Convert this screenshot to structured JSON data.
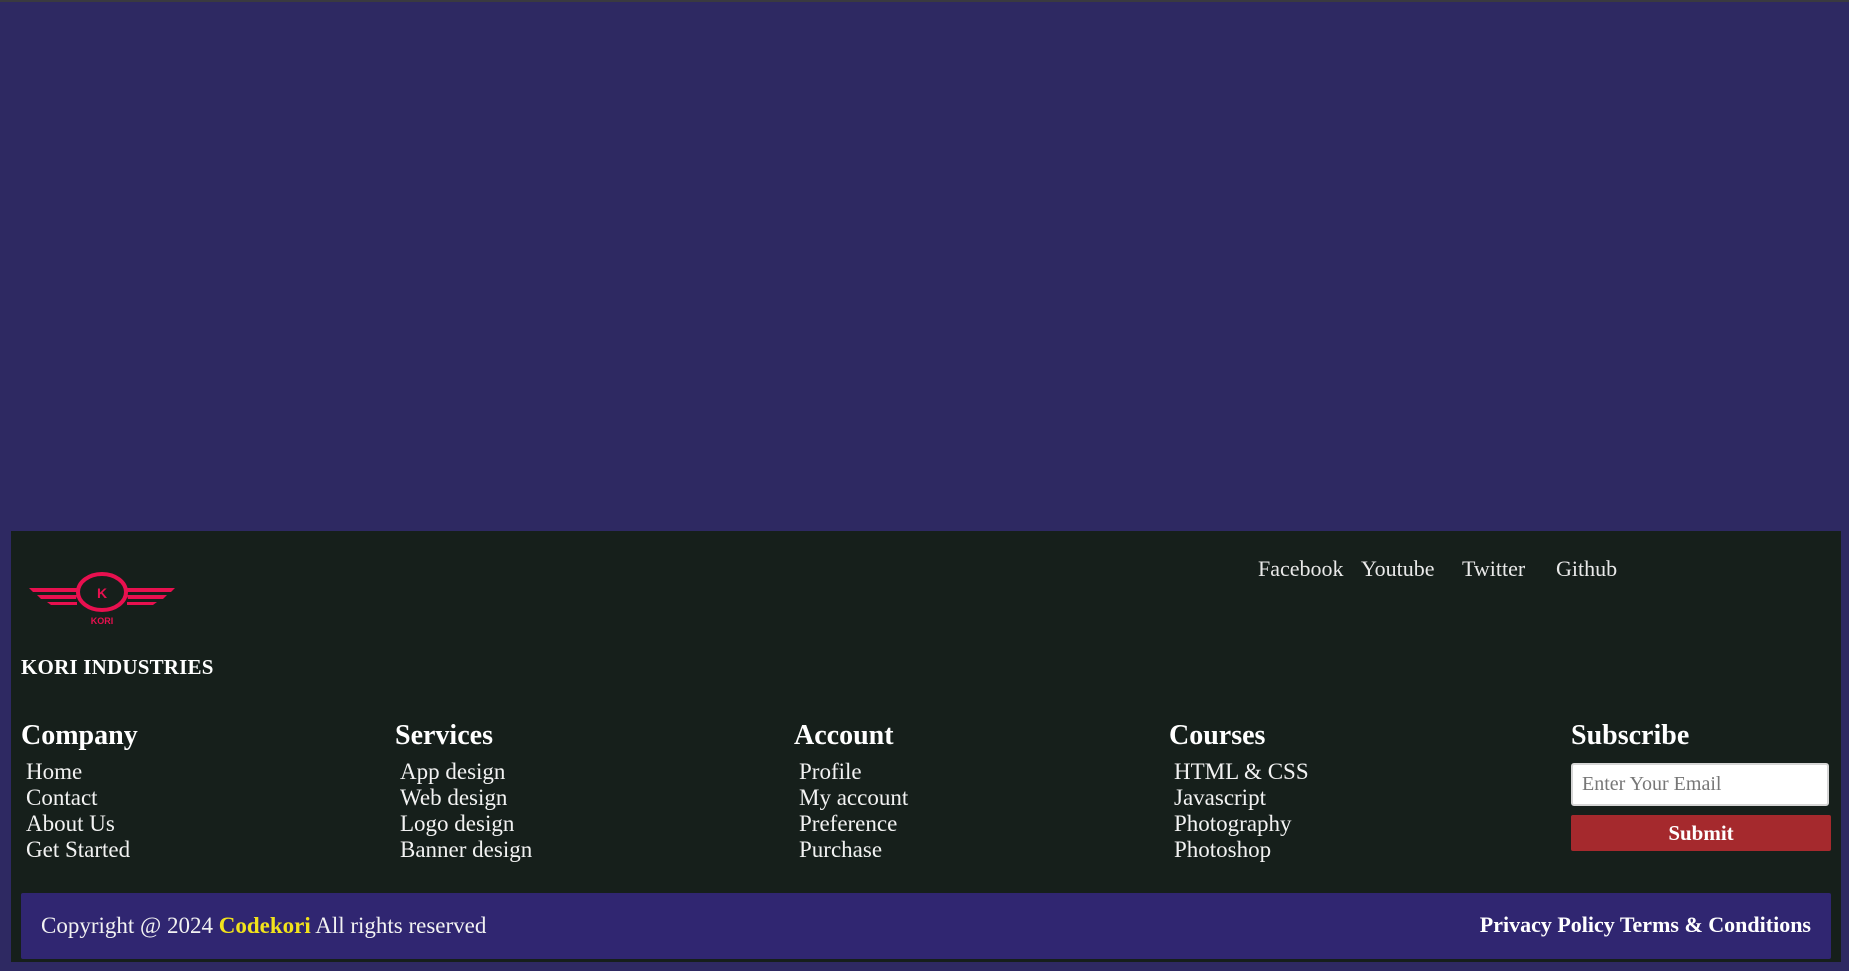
{
  "brand": {
    "logo_label": "KORI",
    "logo_letter": "K",
    "name": "KORI INDUSTRIES",
    "logo_color": "#e8104f"
  },
  "social": {
    "facebook": "Facebook",
    "youtube": "Youtube",
    "twitter": "Twitter",
    "github": "Github"
  },
  "columns": {
    "company": {
      "title": "Company",
      "items": [
        "Home",
        "Contact",
        "About Us",
        "Get Started"
      ]
    },
    "services": {
      "title": "Services",
      "items": [
        "App design",
        "Web design",
        "Logo design",
        "Banner design"
      ]
    },
    "account": {
      "title": "Account",
      "items": [
        "Profile",
        "My account",
        "Preference",
        "Purchase"
      ]
    },
    "courses": {
      "title": "Courses",
      "items": [
        "HTML & CSS",
        "Javascript",
        "Photography",
        "Photoshop"
      ]
    }
  },
  "subscribe": {
    "title": "Subscribe",
    "placeholder": "Enter Your Email",
    "value": "",
    "button_label": "Submit"
  },
  "copyright": {
    "prefix": "Copyright @ 2024",
    "brand": "Codekori",
    "suffix": "All rights reserved"
  },
  "legal": {
    "privacy": "Privacy Policy",
    "terms": "Terms & Conditions"
  },
  "colors": {
    "page_background": "#2e2962",
    "footer_background": "#161f1b",
    "bottom_bar": "#302671",
    "accent_yellow": "#f2e31b",
    "submit_red": "#a5292d"
  }
}
